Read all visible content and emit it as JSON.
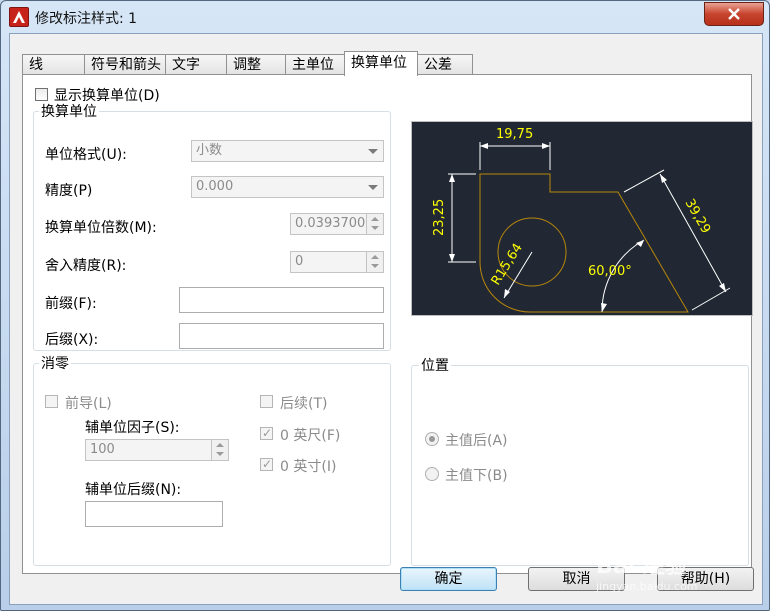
{
  "window": {
    "title": "修改标注样式: 1"
  },
  "tabs": [
    "线",
    "符号和箭头",
    "文字",
    "调整",
    "主单位",
    "换算单位",
    "公差"
  ],
  "active_tab": 5,
  "show_alt": {
    "label": "显示换算单位(D)",
    "checked": false
  },
  "alt_units": {
    "title": "换算单位",
    "unit_format_label": "单位格式(U):",
    "unit_format_value": "小数",
    "precision_label": "精度(P)",
    "precision_value": "0.000",
    "multiplier_label": "换算单位倍数(M):",
    "multiplier_value": "0.0393700",
    "round_label": "舍入精度(R):",
    "round_value": "0",
    "prefix_label": "前缀(F):",
    "prefix_value": "",
    "suffix_label": "后缀(X):",
    "suffix_value": ""
  },
  "zero_suppression": {
    "title": "消零",
    "leading_label": "前导(L)",
    "trailing_label": "后续(T)",
    "subunit_factor_label": "辅单位因子(S):",
    "subunit_factor_value": "100",
    "subunit_suffix_label": "辅单位后缀(N):",
    "subunit_suffix_value": "",
    "zero_feet_label": "0 英尺(F)",
    "zero_inches_label": "0 英寸(I)"
  },
  "placement": {
    "title": "位置",
    "after_primary_label": "主值后(A)",
    "below_primary_label": "主值下(B)",
    "selected": "after"
  },
  "preview": {
    "dim_top": "19,75",
    "dim_left": "23,25",
    "dim_diag": "39,29",
    "dim_radius": "R15,64",
    "dim_angle": "60,00°",
    "line_color": "#b8860b",
    "text_color": "#ffff00",
    "bg_color": "#212833"
  },
  "buttons": {
    "ok": "确定",
    "cancel": "取消",
    "help": "帮助(H)"
  },
  "watermark": {
    "text": "Bai 经验",
    "sub": "jingyan.baidu.com"
  }
}
